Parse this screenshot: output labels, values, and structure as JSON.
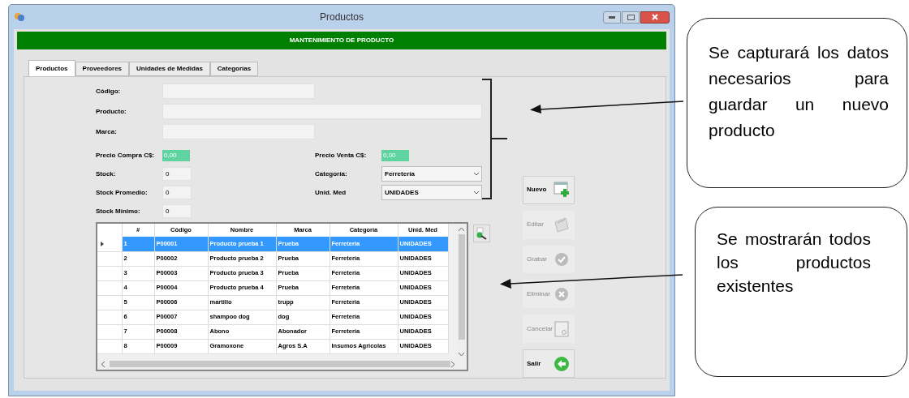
{
  "window": {
    "title": "Productos"
  },
  "banner": "MANTENIMIENTO DE PRODUCTO",
  "tabs": [
    {
      "label": "Productos",
      "selected": true
    },
    {
      "label": "Proveedores",
      "selected": false
    },
    {
      "label": "Unidades de Medidas",
      "selected": false
    },
    {
      "label": "Categorías",
      "selected": false
    }
  ],
  "top_fields": [
    {
      "label": "Código:"
    },
    {
      "label": "Producto:"
    },
    {
      "label": "Marca:"
    }
  ],
  "left_fields": [
    {
      "label": "Precio Compra C$:",
      "value": "0,00",
      "kind": "money"
    },
    {
      "label": "Stock:",
      "value": "0",
      "kind": "number"
    },
    {
      "label": "Stock Promedio:",
      "value": "0",
      "kind": "number"
    },
    {
      "label": "Stock Mínimo:",
      "value": "0",
      "kind": "number"
    }
  ],
  "right_fields": [
    {
      "label": "Precio Venta C$:",
      "value": "0,00",
      "kind": "money"
    },
    {
      "label": "Categoría:",
      "value": "Ferretería",
      "kind": "combo"
    },
    {
      "label": "Unid. Med",
      "value": "UNIDADES",
      "kind": "combo"
    }
  ],
  "table": {
    "columns": [
      "#",
      "Código",
      "Nombre",
      "Marca",
      "Categoría",
      "Unid. Med"
    ],
    "rows": [
      {
        "selected": true,
        "cells": [
          "1",
          "P00001",
          "Producto prueba 1",
          "Prueba",
          "Ferretería",
          "UNIDADES"
        ]
      },
      {
        "selected": false,
        "cells": [
          "2",
          "P00002",
          "Producto prueba 2",
          "Prueba",
          "Ferretería",
          "UNIDADES"
        ]
      },
      {
        "selected": false,
        "cells": [
          "3",
          "P00003",
          "Producto prueba 3",
          "Prueba",
          "Ferretería",
          "UNIDADES"
        ]
      },
      {
        "selected": false,
        "cells": [
          "4",
          "P00004",
          "Producto prueba 4",
          "Prueba",
          "Ferretería",
          "UNIDADES"
        ]
      },
      {
        "selected": false,
        "cells": [
          "5",
          "P00006",
          "martillo",
          "trupp",
          "Ferretería",
          "UNIDADES"
        ]
      },
      {
        "selected": false,
        "cells": [
          "6",
          "P00007",
          "shampoo dog",
          "dog",
          "Ferretería",
          "UNIDADES"
        ]
      },
      {
        "selected": false,
        "cells": [
          "7",
          "P00008",
          "Abono",
          "Abonador",
          "Ferretería",
          "UNIDADES"
        ]
      },
      {
        "selected": false,
        "cells": [
          "8",
          "P00009",
          "Gramoxone",
          "Agros S.A",
          "Insumos Agricolas",
          "UNIDADES"
        ]
      }
    ]
  },
  "buttons": [
    {
      "label": "Nuevo",
      "kind": "new",
      "enabled": true
    },
    {
      "label": "Editar",
      "kind": "edit",
      "enabled": false
    },
    {
      "label": "Grabar",
      "kind": "save",
      "enabled": false
    },
    {
      "label": "Eliminar",
      "kind": "delete",
      "enabled": false
    },
    {
      "label": "Cancelar",
      "kind": "cancel",
      "enabled": false
    },
    {
      "label": "Salir",
      "kind": "exit",
      "enabled": true
    }
  ],
  "annotations": [
    {
      "text": "Se capturará los datos necesarios para guardar un nuevo producto"
    },
    {
      "text": "Se mostrarán todos los productos existentes"
    }
  ]
}
